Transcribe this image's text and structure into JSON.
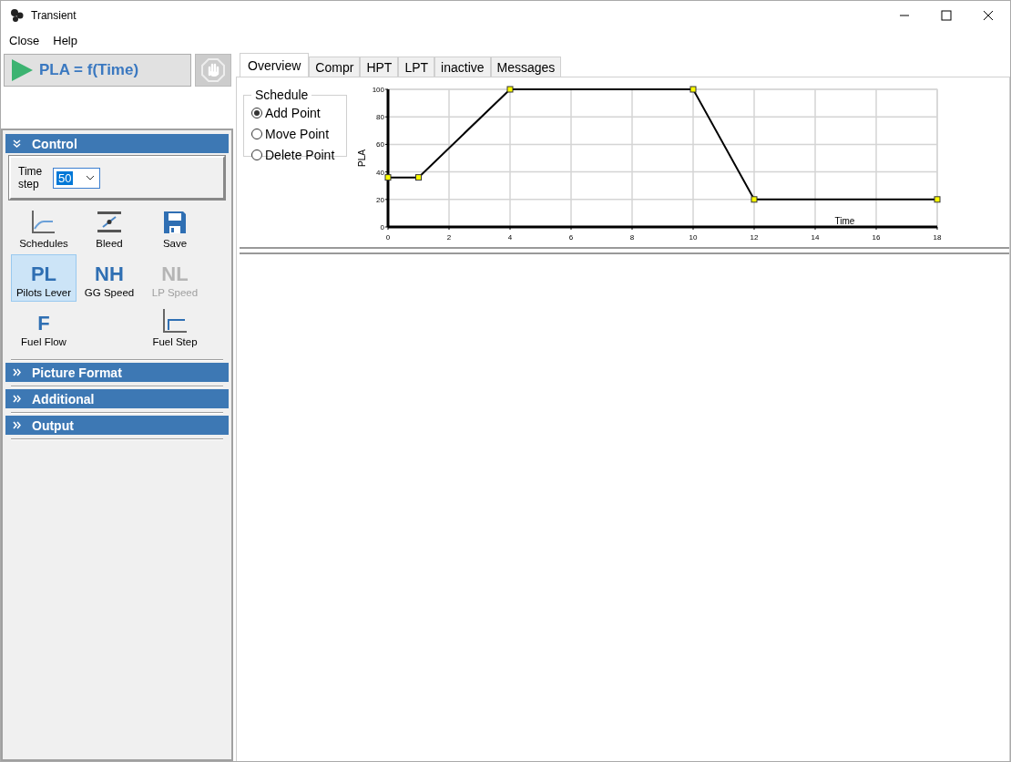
{
  "window": {
    "title": "Transient"
  },
  "menu": [
    "Close",
    "Help"
  ],
  "run_button": {
    "label": "PLA = f(Time)"
  },
  "sidebar": {
    "sections": [
      {
        "title": "Control",
        "expanded": true,
        "time_step": {
          "label": "Time step",
          "value": "50"
        },
        "tools": [
          {
            "label": "Schedules",
            "kind": "curve",
            "selected": false,
            "disabled": false
          },
          {
            "label": "Bleed",
            "kind": "bleed",
            "selected": false,
            "disabled": false
          },
          {
            "label": "Save",
            "kind": "save",
            "selected": false,
            "disabled": false
          },
          {
            "label": "Pilots Lever",
            "kind": "letters",
            "glyph": "PL",
            "selected": true,
            "disabled": false
          },
          {
            "label": "GG Speed",
            "kind": "letters",
            "glyph": "NH",
            "selected": false,
            "disabled": false
          },
          {
            "label": "LP Speed",
            "kind": "letters",
            "glyph": "NL",
            "selected": false,
            "disabled": true
          },
          {
            "label": "Fuel Flow",
            "kind": "letters",
            "glyph": "F",
            "selected": false,
            "disabled": false
          },
          {
            "kind": "blank"
          },
          {
            "label": "Fuel Step",
            "kind": "step",
            "selected": false,
            "disabled": false
          }
        ]
      },
      {
        "title": "Picture Format",
        "expanded": false
      },
      {
        "title": "Additional",
        "expanded": false
      },
      {
        "title": "Output",
        "expanded": false
      }
    ]
  },
  "tabs": [
    {
      "label": "Overview",
      "selected": true
    },
    {
      "label": "Compr",
      "selected": false
    },
    {
      "label": "HPT",
      "selected": false
    },
    {
      "label": "LPT",
      "selected": false
    },
    {
      "label": "inactive",
      "selected": false
    },
    {
      "label": "Messages",
      "selected": false
    }
  ],
  "schedule": {
    "title": "Schedule",
    "options": [
      {
        "label": "Add Point",
        "selected": true
      },
      {
        "label": "Move Point",
        "selected": false
      },
      {
        "label": "Delete Point",
        "selected": false
      }
    ]
  },
  "chart_data": {
    "type": "line",
    "xlabel": "Time",
    "ylabel": "PLA",
    "x": [
      0,
      1,
      4,
      10,
      12,
      18
    ],
    "grid": true,
    "series": [
      {
        "color": "#000000",
        "marker": "square",
        "values": [
          36,
          36,
          100,
          100,
          20,
          20
        ]
      }
    ],
    "xlim": [
      0,
      18
    ],
    "ylim": [
      0,
      100
    ],
    "xticks": [
      0,
      2,
      4,
      6,
      8,
      10,
      12,
      14,
      16,
      18
    ],
    "yticks": [
      0,
      20,
      40,
      60,
      80,
      100
    ]
  }
}
